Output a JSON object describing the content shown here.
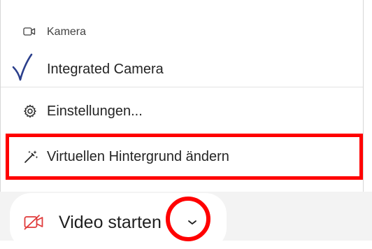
{
  "menu": {
    "header": {
      "label": "Kamera",
      "icon": "camera-icon"
    },
    "items": [
      {
        "label": "Integrated Camera",
        "icon": "checkmark-icon",
        "selected": true
      },
      {
        "label": "Einstellungen...",
        "icon": "gear-icon"
      },
      {
        "label": "Virtuellen Hintergrund ändern",
        "icon": "magic-wand-icon"
      }
    ]
  },
  "video_button": {
    "label": "Video starten",
    "icon": "video-off-icon",
    "chevron_icon": "chevron-down-icon"
  },
  "colors": {
    "annotation": "#ff0000",
    "checkmark": "#2b3f8c",
    "video_icon": "#e03a3a"
  }
}
